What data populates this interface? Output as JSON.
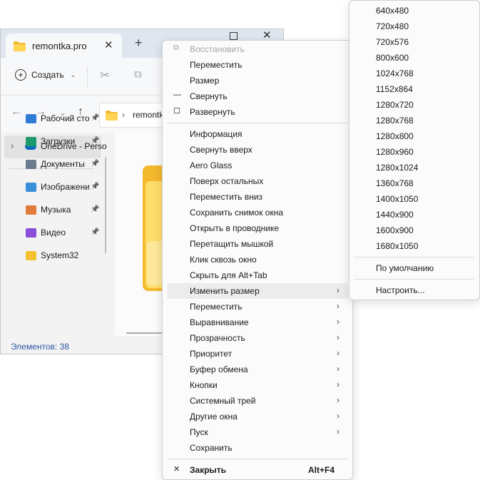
{
  "explorer": {
    "tab_title": "remontka.pro",
    "tab_close_icon": "✕",
    "new_tab_icon": "+",
    "close_icon": "✕",
    "toolbar": {
      "create_label": "Создать"
    },
    "address_text": "remontk",
    "sidebar": {
      "onedrive_label": "OneDrive - Perso",
      "items": [
        {
          "label": "Рабочий сто",
          "icon": "desktop-icon",
          "color": "#2f7bd6",
          "pinned": true
        },
        {
          "label": "Загрузки",
          "icon": "download-icon",
          "color": "#1d9a6c",
          "pinned": true
        },
        {
          "label": "Документы",
          "icon": "documents-icon",
          "color": "#6b7a8c",
          "pinned": true
        },
        {
          "label": "Изображени",
          "icon": "pictures-icon",
          "color": "#3a8fd9",
          "pinned": true
        },
        {
          "label": "Музыка",
          "icon": "music-icon",
          "color": "#e07b39",
          "pinned": true
        },
        {
          "label": "Видео",
          "icon": "video-icon",
          "color": "#8a4fd6",
          "pinned": true
        },
        {
          "label": "System32",
          "icon": "folder-icon",
          "color": "#f2c230",
          "pinned": false
        }
      ]
    },
    "status": "Элементов: 38"
  },
  "context_menu": {
    "items": [
      {
        "label": "Восстановить",
        "icon": "restore-icon",
        "glyph": "⧉",
        "disabled": true
      },
      {
        "label": "Переместить"
      },
      {
        "label": "Размер"
      },
      {
        "label": "Свернуть",
        "icon": "minimize-icon",
        "glyph": "—"
      },
      {
        "label": "Развернуть",
        "icon": "maximize-icon",
        "glyph": "☐"
      },
      {
        "separator": true
      },
      {
        "label": "Информация"
      },
      {
        "label": "Свернуть вверх"
      },
      {
        "label": "Aero Glass"
      },
      {
        "label": "Поверх остальных"
      },
      {
        "label": "Переместить вниз"
      },
      {
        "label": "Сохранить снимок окна"
      },
      {
        "label": "Открыть в проводнике"
      },
      {
        "label": "Перетащить мышкой"
      },
      {
        "label": "Клик сквозь окно"
      },
      {
        "label": "Скрыть для Alt+Tab"
      },
      {
        "label": "Изменить размер",
        "submenu": true,
        "highlighted": true
      },
      {
        "label": "Переместить",
        "submenu": true
      },
      {
        "label": "Выравнивание",
        "submenu": true
      },
      {
        "label": "Прозрачность",
        "submenu": true
      },
      {
        "label": "Приоритет",
        "submenu": true
      },
      {
        "label": "Буфер обмена",
        "submenu": true
      },
      {
        "label": "Кнопки",
        "submenu": true
      },
      {
        "label": "Системный трей",
        "submenu": true
      },
      {
        "label": "Другие окна",
        "submenu": true
      },
      {
        "label": "Пуск",
        "submenu": true
      },
      {
        "label": "Сохранить"
      },
      {
        "separator": true
      },
      {
        "label": "Закрыть",
        "icon": "close-icon",
        "glyph": "✕",
        "shortcut": "Alt+F4"
      }
    ]
  },
  "resize_submenu": {
    "sizes": [
      "640x480",
      "720x480",
      "720x576",
      "800x600",
      "1024x768",
      "1152x864",
      "1280x720",
      "1280x768",
      "1280x800",
      "1280x960",
      "1280x1024",
      "1360x768",
      "1400x1050",
      "1440x900",
      "1600x900",
      "1680x1050"
    ],
    "default_label": "По умолчанию",
    "customize_label": "Настроить..."
  }
}
